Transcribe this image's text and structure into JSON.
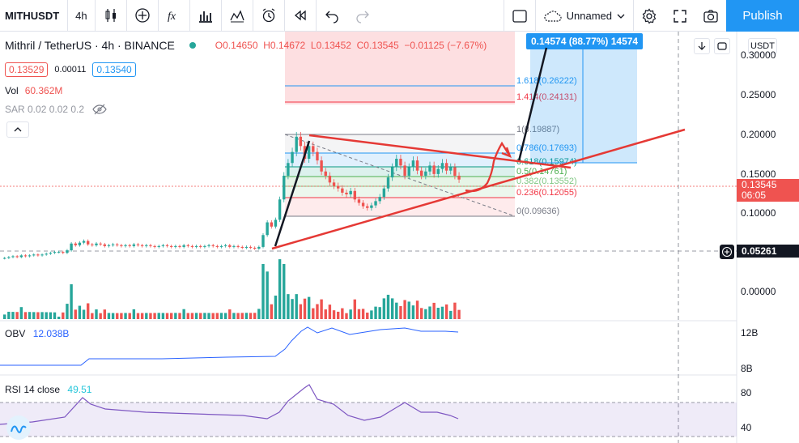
{
  "toolbar": {
    "symbol": "MITHUSDT",
    "interval": "4h",
    "layout_name": "Unnamed",
    "publish_label": "Publish"
  },
  "legend": {
    "title": "Mithril / TetherUS · 4h · BINANCE",
    "open": "O0.14650",
    "high": "H0.14672",
    "low": "L0.13452",
    "close": "C0.13545",
    "change": "−0.01125 (−7.67%)",
    "bid": "0.13529",
    "spread": "0.00011",
    "ask": "0.13540",
    "vol_label": "Vol",
    "vol_value": "60.362M",
    "sar_label": "SAR 0.02 0.02 0.2"
  },
  "currency_btn": "USDT",
  "price_axis": {
    "ticks": [
      "0.30000",
      "0.25000",
      "0.20000",
      "0.15000",
      "0.10000",
      "0.05261",
      "0.00000"
    ],
    "last_price": "0.13545",
    "countdown": "06:05",
    "crosshair_price": "0.05261"
  },
  "position_label": "0.14574 (88.77%) 14574",
  "fib_levels": [
    {
      "label": "1.618(0.26222)",
      "color": "#2196f3"
    },
    {
      "label": "1.414(0.24131)",
      "color": "#f23645"
    },
    {
      "label": "1(0.19887)",
      "color": "#787b86"
    },
    {
      "label": "0.786(0.17693)",
      "color": "#2196f3"
    },
    {
      "label": "0.618(0.15974)",
      "color": "#089981"
    },
    {
      "label": "0.5(0.14761)",
      "color": "#4caf50"
    },
    {
      "label": "0.382(0.13552)",
      "color": "#81c784"
    },
    {
      "label": "0.236(0.12055)",
      "color": "#f23645"
    },
    {
      "label": "0(0.09636)",
      "color": "#787b86"
    }
  ],
  "obv": {
    "label": "OBV",
    "value": "12.038B",
    "ticks": [
      "12B",
      "8B"
    ]
  },
  "rsi": {
    "label": "RSI 14 close",
    "value": "49.51",
    "ticks": [
      "80",
      "40"
    ]
  },
  "chart_data": {
    "type": "candlestick",
    "symbol": "MITHUSDT",
    "interval": "4h",
    "exchange": "BINANCE",
    "y_range": [
      -0.01,
      0.31
    ],
    "candles_close": [
      0.043,
      0.044,
      0.045,
      0.044,
      0.046,
      0.045,
      0.046,
      0.047,
      0.046,
      0.047,
      0.048,
      0.049,
      0.05,
      0.05,
      0.049,
      0.052,
      0.06,
      0.058,
      0.061,
      0.063,
      0.059,
      0.058,
      0.06,
      0.059,
      0.057,
      0.058,
      0.059,
      0.058,
      0.057,
      0.058,
      0.057,
      0.059,
      0.058,
      0.057,
      0.058,
      0.057,
      0.056,
      0.057,
      0.058,
      0.057,
      0.056,
      0.057,
      0.056,
      0.058,
      0.057,
      0.056,
      0.057,
      0.056,
      0.057,
      0.058,
      0.057,
      0.056,
      0.057,
      0.058,
      0.056,
      0.057,
      0.056,
      0.055,
      0.056,
      0.055,
      0.054,
      0.056,
      0.07,
      0.085,
      0.08,
      0.088,
      0.112,
      0.14,
      0.155,
      0.168,
      0.186,
      0.175,
      0.16,
      0.175,
      0.168,
      0.158,
      0.145,
      0.14,
      0.132,
      0.128,
      0.125,
      0.12,
      0.118,
      0.122,
      0.112,
      0.108,
      0.104,
      0.102,
      0.105,
      0.11,
      0.115,
      0.125,
      0.138,
      0.15,
      0.16,
      0.152,
      0.14,
      0.15,
      0.158,
      0.146,
      0.14,
      0.145,
      0.152,
      0.142,
      0.148,
      0.155,
      0.146,
      0.15,
      0.14,
      0.1355
    ]
  }
}
